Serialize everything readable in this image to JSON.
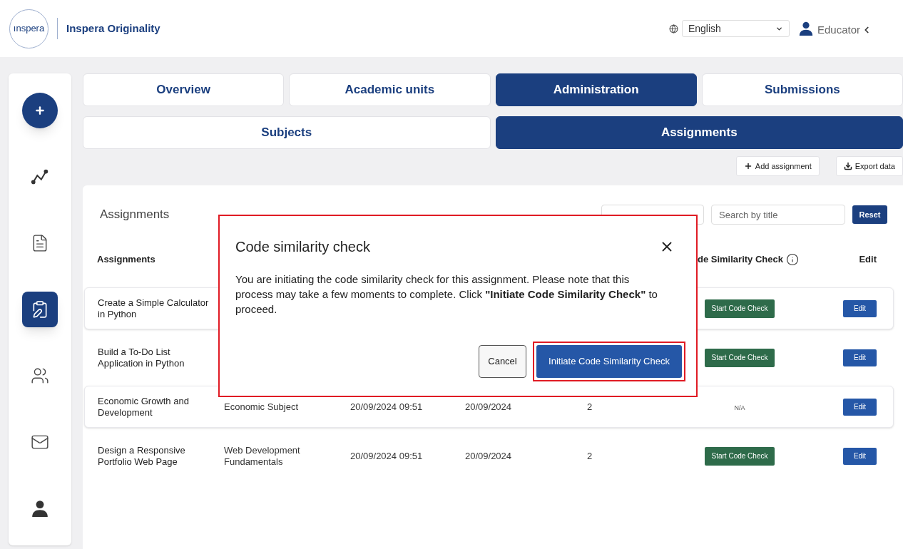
{
  "header": {
    "logo_text": "ınspera",
    "product": "Inspera Originality",
    "language": "English",
    "user": "Educator"
  },
  "sidebar": {
    "items": [
      {
        "kind": "chart",
        "selected": false
      },
      {
        "kind": "reports",
        "selected": false
      },
      {
        "kind": "assignments",
        "selected": true
      },
      {
        "kind": "users",
        "selected": false
      },
      {
        "kind": "mail",
        "selected": false
      },
      {
        "kind": "profile",
        "selected": false
      }
    ]
  },
  "nav_tabs": [
    [
      {
        "label": "Overview",
        "selected": false
      },
      {
        "label": "Academic units",
        "selected": false
      },
      {
        "label": "Administration",
        "selected": true
      },
      {
        "label": "Submissions",
        "selected": false
      }
    ],
    [
      {
        "label": "Subjects",
        "selected": false
      },
      {
        "label": "Assignments",
        "selected": true
      }
    ]
  ],
  "actions": [
    {
      "kind": "add",
      "label": "Add assignment"
    },
    {
      "kind": "export",
      "label": "Export data"
    }
  ],
  "panel": {
    "title": "Assignments",
    "search_placeholder": "Search by title",
    "reset": "Reset",
    "header_name": "Assignments",
    "header_code_check": "de Similarity Check",
    "header_edit": "Edit",
    "rows": [
      {
        "name": "Create a Simple Calculator in Python",
        "raised": true,
        "code_check": {
          "kind": "button",
          "label": "Start Code Check"
        },
        "edit": "Edit"
      },
      {
        "name": "Build a To-Do List Application in Python",
        "raised": false,
        "code_check": {
          "kind": "button",
          "label": "Start Code Check"
        },
        "edit": "Edit"
      },
      {
        "name": "Economic Growth and Development",
        "subject": "Economic Subject",
        "created": "20/09/2024 09:51",
        "deadline": "20/09/2024",
        "count": "2",
        "raised": true,
        "code_check": {
          "kind": "na",
          "label": "N/A"
        },
        "edit": "Edit"
      },
      {
        "name": "Design a Responsive Portfolio Web Page",
        "subject": "Web Development Fundamentals",
        "created": "20/09/2024 09:51",
        "deadline": "20/09/2024",
        "count": "2",
        "raised": false,
        "code_check": {
          "kind": "button",
          "label": "Start Code Check"
        },
        "edit": "Edit"
      }
    ]
  },
  "modal": {
    "title": "Code similarity check",
    "body": "You are initiating the code similarity check for this assignment. Please note that this process may take a few moments to complete. Click **\"Initiate Code Similarity Check\"** to proceed.",
    "cancel": "Cancel",
    "confirm": "Initiate Code Similarity Check",
    "highlighted": true,
    "confirm_highlighted": true
  }
}
